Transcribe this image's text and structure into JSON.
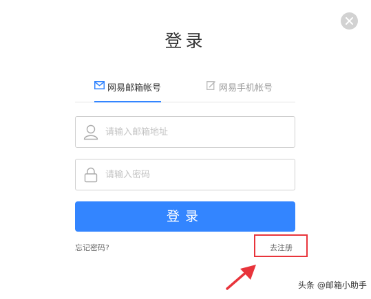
{
  "dialog": {
    "title": "登录",
    "close_icon": "close-icon"
  },
  "tabs": [
    {
      "label": "网易邮箱帐号",
      "icon": "envelope-icon",
      "active": true
    },
    {
      "label": "网易手机帐号",
      "icon": "phone-edit-icon",
      "active": false
    }
  ],
  "email_field": {
    "placeholder": "请输入邮箱地址",
    "value": "",
    "icon": "user-icon"
  },
  "password_field": {
    "placeholder": "请输入密码",
    "value": "",
    "icon": "lock-icon"
  },
  "login_button": {
    "label": "登录"
  },
  "forgot_link": {
    "label": "忘记密码?"
  },
  "register_link": {
    "label": "去注册"
  },
  "annotation": {
    "box_color": "#e8343b",
    "arrow_color": "#e8343b"
  },
  "watermark": {
    "text": "头条 @邮箱小助手"
  },
  "colors": {
    "accent": "#3385ff",
    "close_bg": "#d2d2d2"
  }
}
